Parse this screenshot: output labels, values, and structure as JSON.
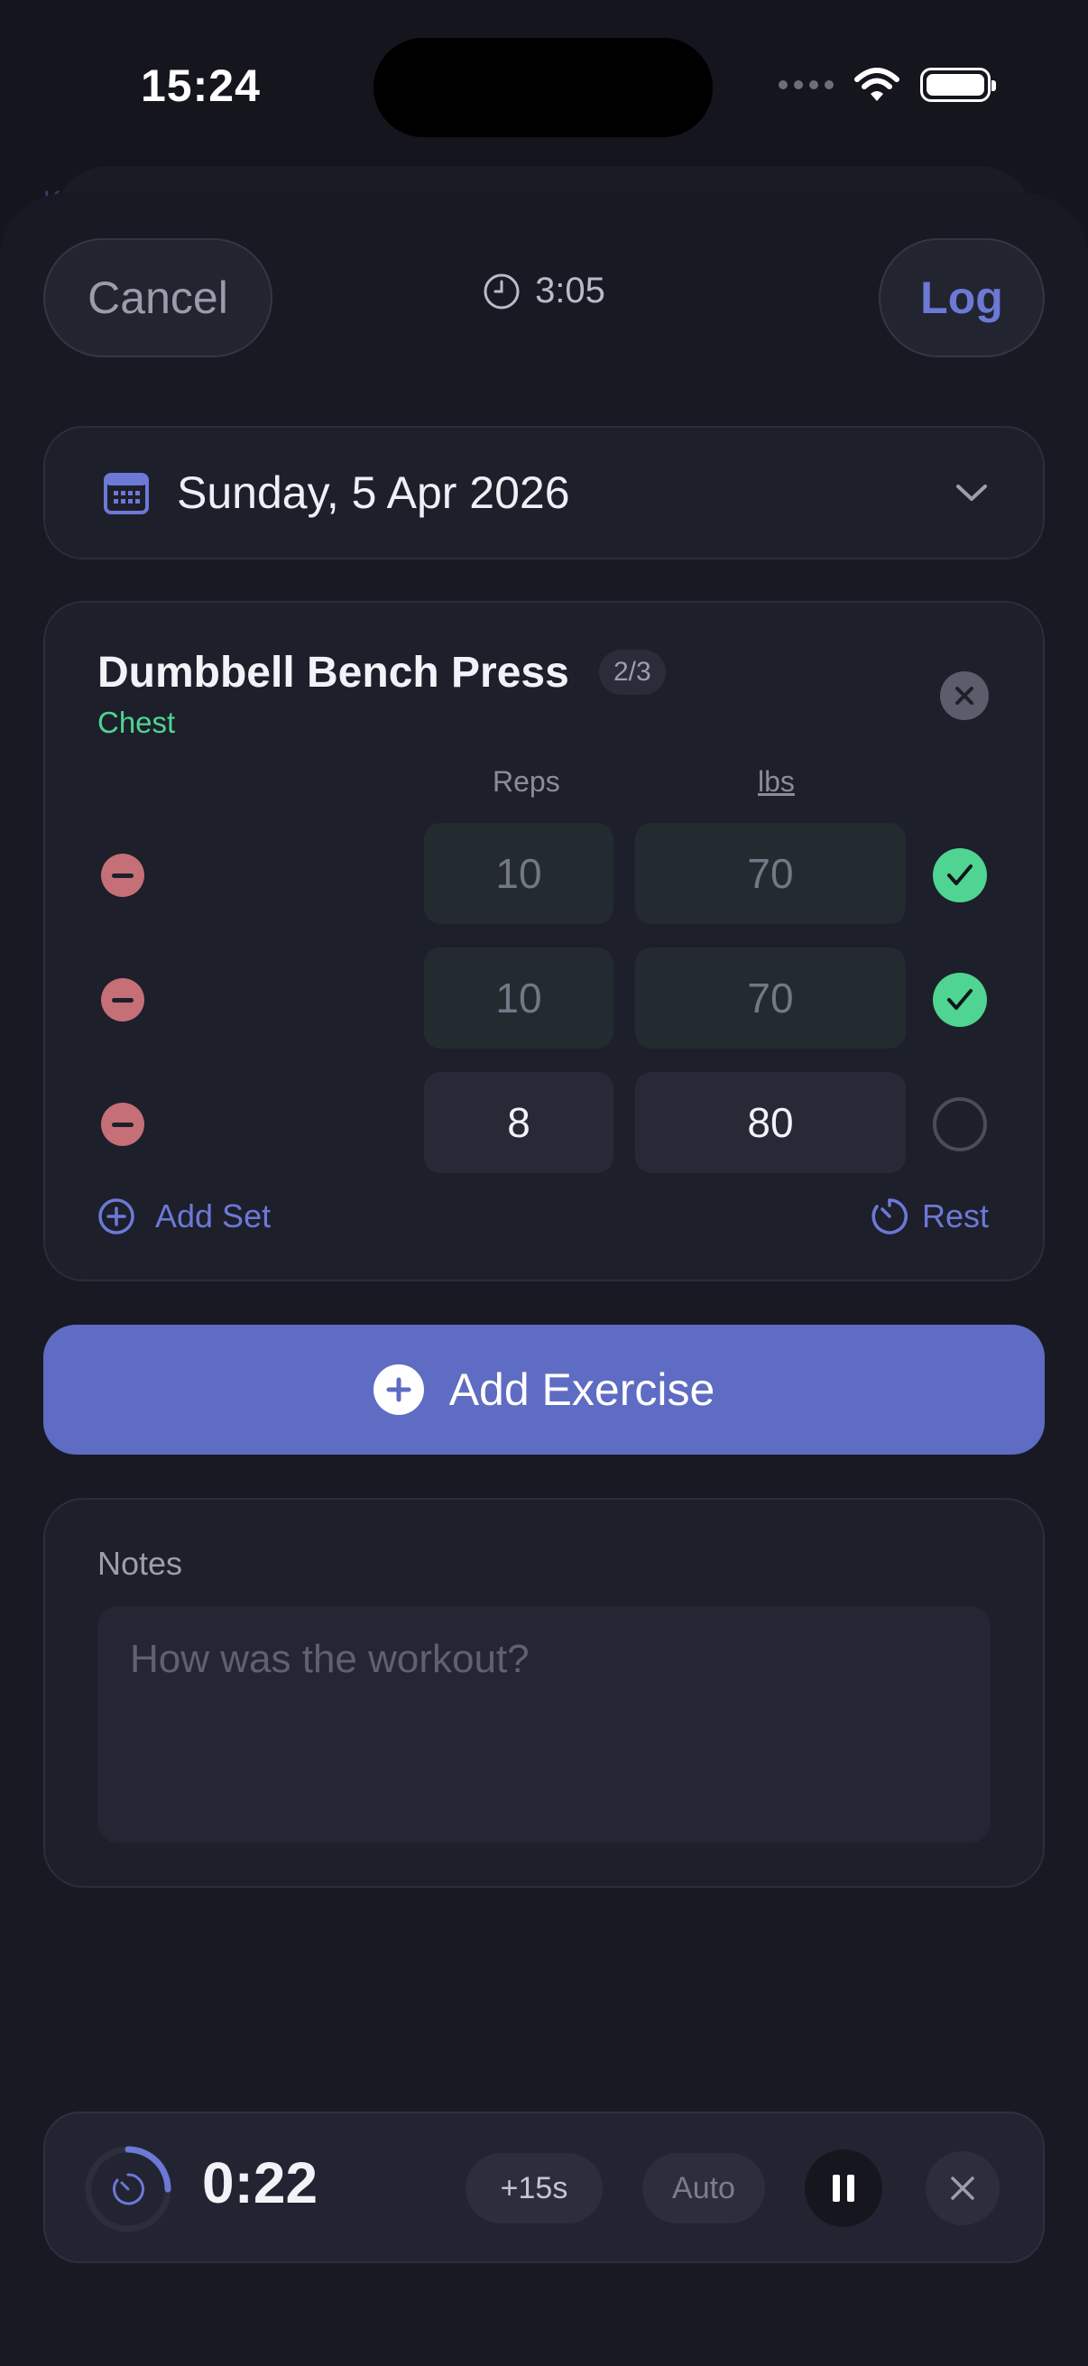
{
  "status_bar": {
    "time": "15:24"
  },
  "header": {
    "cancel_label": "Cancel",
    "elapsed": "3:05",
    "log_label": "Log",
    "behind_letter": "K"
  },
  "date_picker": {
    "value": "Sunday, 5 Apr 2026"
  },
  "exercise": {
    "name": "Dumbbell Bench Press",
    "progress": "2/3",
    "muscle": "Chest",
    "col_reps": "Reps",
    "col_weight": "lbs",
    "sets": [
      {
        "reps": "10",
        "weight": "70",
        "done": true
      },
      {
        "reps": "10",
        "weight": "70",
        "done": true
      },
      {
        "reps": "8",
        "weight": "80",
        "done": false
      }
    ],
    "add_set_label": "Add Set",
    "rest_label": "Rest"
  },
  "add_exercise_label": "Add Exercise",
  "notes": {
    "label": "Notes",
    "placeholder": "How was the workout?",
    "value": ""
  },
  "rest_timer": {
    "time": "0:22",
    "progress": 0.25,
    "add_label": "+15s",
    "auto_label": "Auto"
  },
  "colors": {
    "accent": "#5f6cc3",
    "accent_text": "#6c79d6",
    "success": "#4fd491",
    "danger": "#c56f77",
    "background": "#14151d",
    "card": "#1d1f2b"
  }
}
